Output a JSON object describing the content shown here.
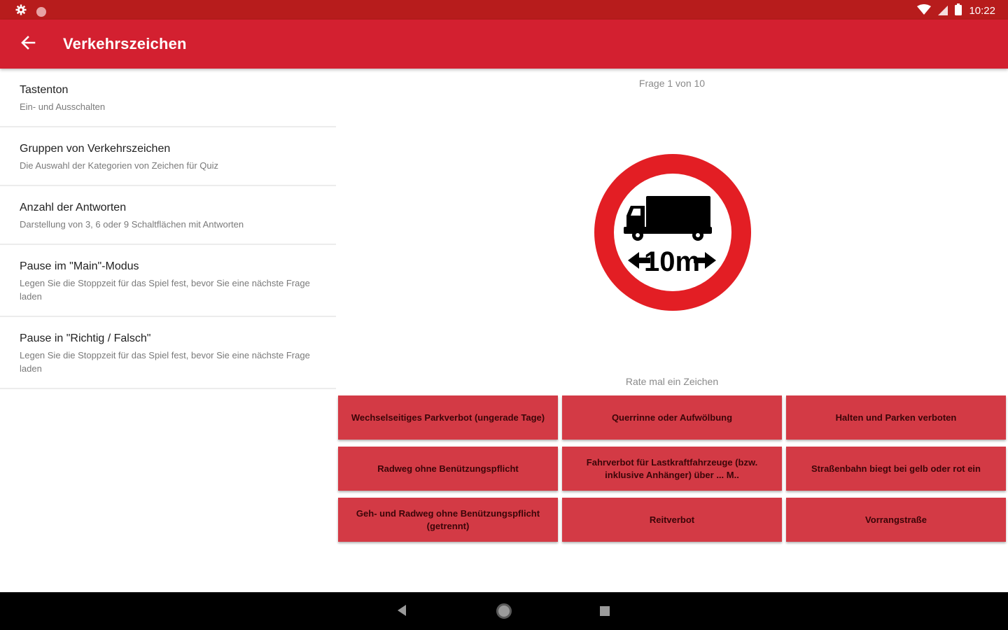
{
  "status_bar": {
    "time": "10:22",
    "left_icons": [
      "settings-icon",
      "notification-dot-icon"
    ],
    "right_icons": [
      "wifi-icon",
      "signal-icon",
      "battery-icon"
    ]
  },
  "app_bar": {
    "title": "Verkehrszeichen",
    "back_icon": "arrow-back-icon",
    "color": "#d32030"
  },
  "settings": [
    {
      "title": "Tastenton",
      "subtitle": "Ein- und Ausschalten"
    },
    {
      "title": "Gruppen von Verkehrszeichen",
      "subtitle": "Die Auswahl der Kategorien von Zeichen für Quiz"
    },
    {
      "title": "Anzahl der Antworten",
      "subtitle": "Darstellung von 3, 6 oder 9 Schaltflächen mit Antworten"
    },
    {
      "title": "Pause im \"Main\"-Modus",
      "subtitle": "Legen Sie die Stoppzeit für das Spiel fest, bevor Sie eine nächste Frage laden"
    },
    {
      "title": "Pause in \"Richtig / Falsch\"",
      "subtitle": "Legen Sie die Stoppzeit für das Spiel fest, bevor Sie eine nächste Frage laden"
    }
  ],
  "quiz": {
    "counter": "Frage 1 von 10",
    "prompt": "Rate mal ein Zeichen",
    "sign": {
      "icon": "truck-length-limit-sign-icon",
      "label": "10m"
    },
    "answers": [
      "Wechselseitiges Parkverbot (ungerade Tage)",
      "Querrinne oder Aufwölbung",
      "Halten und Parken verboten",
      "Radweg ohne Benützungspflicht",
      "Fahrverbot für Lastkraftfahrzeuge (bzw. inklusive Anhänger) über ... M..",
      "Straßenbahn biegt bei gelb oder rot ein",
      "Geh- und Radweg ohne Benützungspflicht (getrennt)",
      "Reitverbot",
      "Vorrangstraße"
    ],
    "answer_color": "#d33a45"
  },
  "nav_bar": {
    "buttons": [
      "back-triangle-icon",
      "home-circle-icon",
      "recents-square-icon"
    ]
  }
}
